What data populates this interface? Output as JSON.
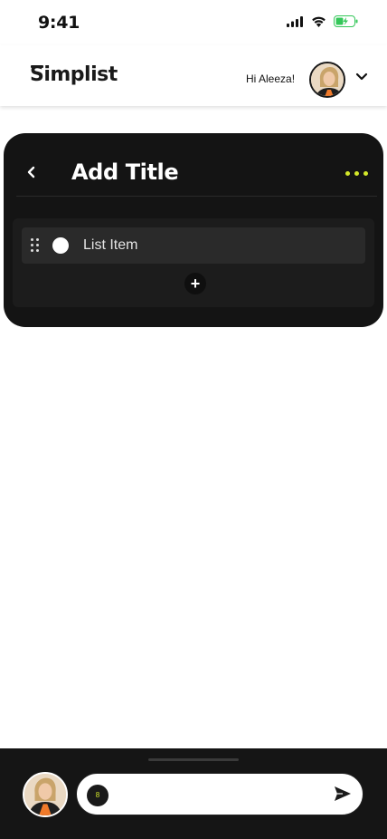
{
  "status": {
    "time": "9:41"
  },
  "header": {
    "logo": "Simplist",
    "greeting": "Hi Aleeza!"
  },
  "card": {
    "title": "Add Title",
    "items": [
      {
        "label": "List Item",
        "checked": false
      }
    ]
  },
  "composer": {
    "counter": "8",
    "placeholder": ""
  },
  "colors": {
    "accent": "#d4e82a",
    "card_bg": "#141414",
    "battery": "#34c759"
  },
  "icons": [
    "signal-icon",
    "wifi-icon",
    "battery-icon",
    "chevron-down-icon",
    "back-icon",
    "more-icon",
    "drag-handle-icon",
    "plus-icon",
    "send-icon"
  ]
}
